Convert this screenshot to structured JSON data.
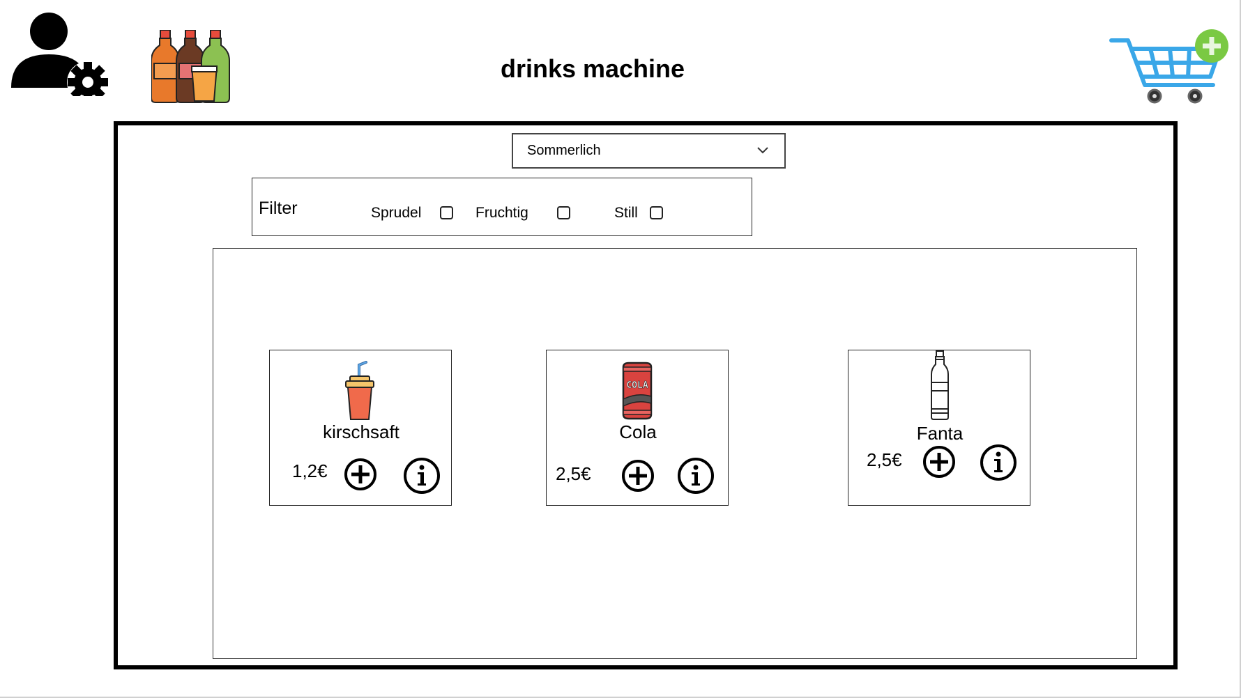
{
  "header": {
    "title": "drinks machine",
    "admin_icon": "user-settings-icon",
    "logo_icon": "soda-bottles-icon",
    "cart_icon": "cart-add-icon"
  },
  "season_select": {
    "selected": "Sommerlich"
  },
  "filter": {
    "label": "Filter",
    "options": [
      {
        "label": "Sprudel",
        "checked": false
      },
      {
        "label": "Fruchtig",
        "checked": false
      },
      {
        "label": "Still",
        "checked": false
      }
    ]
  },
  "products": [
    {
      "name": "kirschsaft",
      "price": "1,2€",
      "icon": "cup-with-straw-icon"
    },
    {
      "name": "Cola",
      "price": "2,5€",
      "icon": "cola-can-icon"
    },
    {
      "name": "Fanta",
      "price": "2,5€",
      "icon": "bottle-icon"
    }
  ],
  "colors": {
    "accent_cart": "#3aa7e8",
    "add_badge": "#7ac943",
    "bottle_orange": "#e8792b",
    "bottle_brown": "#6b3a24",
    "bottle_green": "#8cc152",
    "cup_red": "#f06a4b",
    "can_red": "#d9433f"
  }
}
